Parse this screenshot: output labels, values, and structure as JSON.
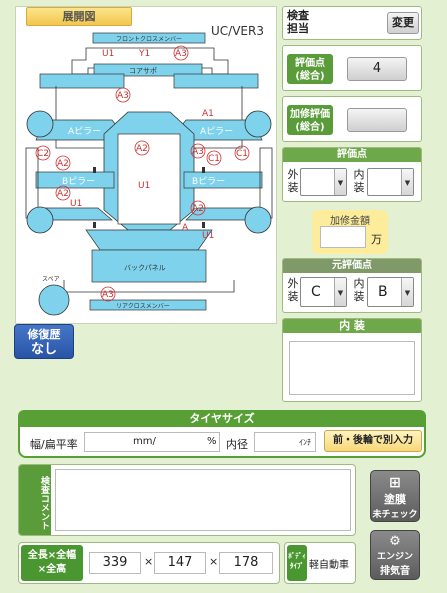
{
  "diagram": {
    "tab_label": "展開図",
    "version": "UC/VER3",
    "labels": {
      "front_cross": "フロントクロスメンバー",
      "core_support": "コアサポ",
      "a_pillar_l": "Aピラー",
      "a_pillar_r": "Aピラー",
      "b_pillar_l": "Bピラー",
      "b_pillar_r": "Bピラー",
      "back_panel": "バックパネル",
      "rear_cross": "リアクロスメンバー",
      "spare": "スペア"
    },
    "marks": {
      "u1_top": "U1",
      "y1_top": "Y1",
      "a3_top": "A3",
      "a3_hood": "A3",
      "a1_right": "A1",
      "a2_roof": "A2",
      "a3_pillar_r": "A3",
      "c1_right": "C1",
      "c1_edge": "C1",
      "c2_left": "C2",
      "a2_left": "A2",
      "u1_center": "U1",
      "a2_lower_left": "A2",
      "u1_lower_left": "U1",
      "a2_lower_right": "A2",
      "a_lower_right": "A",
      "u1_lower_right": "U1",
      "a3_bottom": "A3"
    }
  },
  "repair_history": {
    "line1": "修復歴",
    "line2": "なし"
  },
  "inspector": {
    "label_line1": "検査",
    "label_line2": "担当",
    "change_button": "変更"
  },
  "overall_score": {
    "label_line1": "評価点",
    "label_line2": "(総合)",
    "value": "4"
  },
  "repair_score": {
    "label_line1": "加修評価",
    "label_line2": "(総合)",
    "value": ""
  },
  "score": {
    "title": "評価点",
    "exterior_label": [
      "外",
      "装"
    ],
    "interior_label": [
      "内",
      "装"
    ],
    "exterior_value": "",
    "interior_value": ""
  },
  "repair_amount": {
    "title": "加修金額",
    "value": "",
    "unit": "万"
  },
  "original_score": {
    "title": "元評価点",
    "exterior_label": [
      "外",
      "装"
    ],
    "interior_label": [
      "内",
      "装"
    ],
    "exterior_value": "C",
    "interior_value": "B"
  },
  "interior": {
    "title": "内 装",
    "value": ""
  },
  "tire": {
    "title": "タイヤサイズ",
    "width_label": "幅/扁平率",
    "mm_unit": "mm/",
    "pct_unit": "%",
    "inner_label": "内径",
    "inch_unit": "ｲﾝﾁ",
    "split_button": "前・後輪で別入力"
  },
  "comment": {
    "label": [
      "検査",
      "コメント"
    ],
    "value": ""
  },
  "paint_button": {
    "line1": "塗膜",
    "line2": "未チェック"
  },
  "dimensions": {
    "label_line1": "全長×全幅",
    "label_line2": "×全高",
    "length": "339",
    "width": "147",
    "height": "178",
    "times": "×"
  },
  "body_type": {
    "label_line1": "ﾎﾞﾃﾞｨ",
    "label_line2": "ﾀｲﾌﾟ",
    "value": "軽自動車"
  },
  "engine_button": {
    "line1": "エンジン",
    "line2": "排気音"
  },
  "colors": {
    "panel_blue": "#7fd2ec",
    "mark_red": "#d03030",
    "header_green": "#6fa84a",
    "repair_blue": "#2f5db0",
    "tire_head": "#58a035",
    "dim_green": "#4a9630"
  }
}
